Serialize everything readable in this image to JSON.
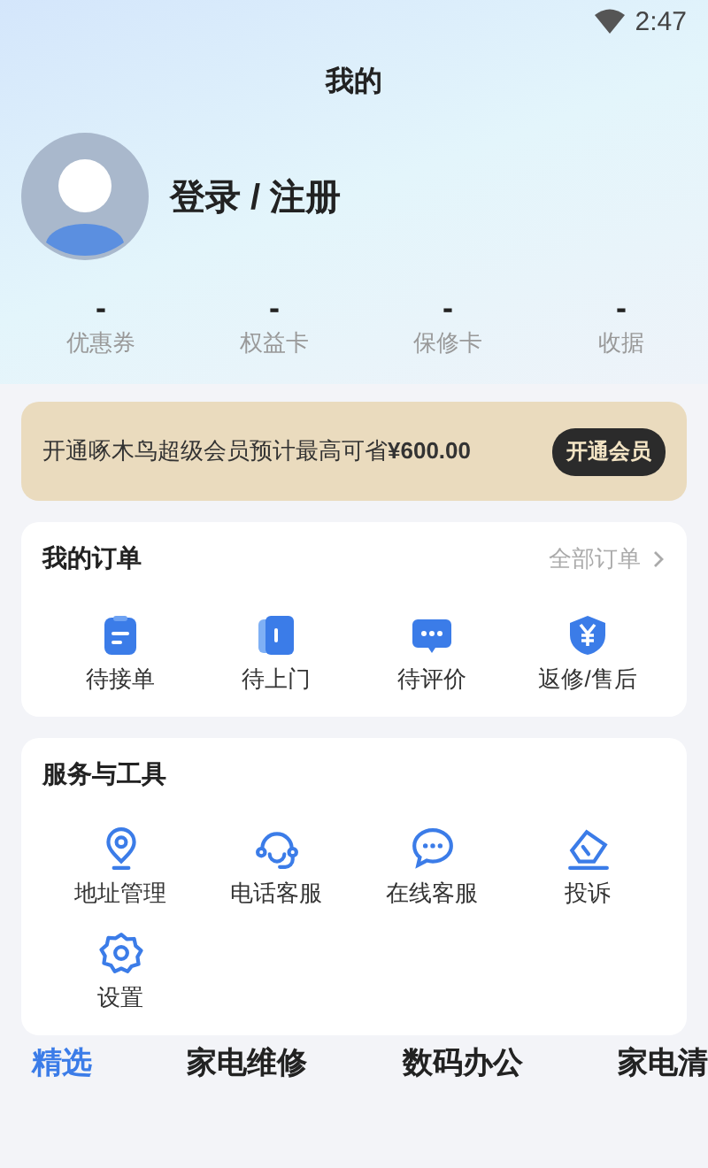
{
  "status_bar": {
    "time": "2:47"
  },
  "title": "我的",
  "profile": {
    "name": "登录 / 注册"
  },
  "stats": [
    {
      "value": "-",
      "label": "优惠券"
    },
    {
      "value": "-",
      "label": "权益卡"
    },
    {
      "value": "-",
      "label": "保修卡"
    },
    {
      "value": "-",
      "label": "收据"
    }
  ],
  "banner": {
    "text": "开通啄木鸟超级会员预计最高可省**¥600.00**",
    "button": "开通会员"
  },
  "orders": {
    "title": "我的订单",
    "link": "全部订单",
    "items": [
      {
        "kind": "clipboard",
        "label": "待接单"
      },
      {
        "kind": "door",
        "label": "待上门"
      },
      {
        "kind": "chat",
        "label": "待评价"
      },
      {
        "kind": "shield",
        "label": "返修/售后"
      }
    ]
  },
  "services": {
    "title": "服务与工具",
    "items": [
      {
        "kind": "pin",
        "label": "地址管理"
      },
      {
        "kind": "headset",
        "label": "电话客服"
      },
      {
        "kind": "bubble",
        "label": "在线客服"
      },
      {
        "kind": "pen",
        "label": "投诉"
      },
      {
        "kind": "gear",
        "label": "设置"
      }
    ]
  },
  "tabs": [
    {
      "label": "精选",
      "selected": true
    },
    {
      "label": "家电维修",
      "selected": false
    },
    {
      "label": "数码办公",
      "selected": false
    },
    {
      "label": "家电清",
      "selected": false
    }
  ]
}
